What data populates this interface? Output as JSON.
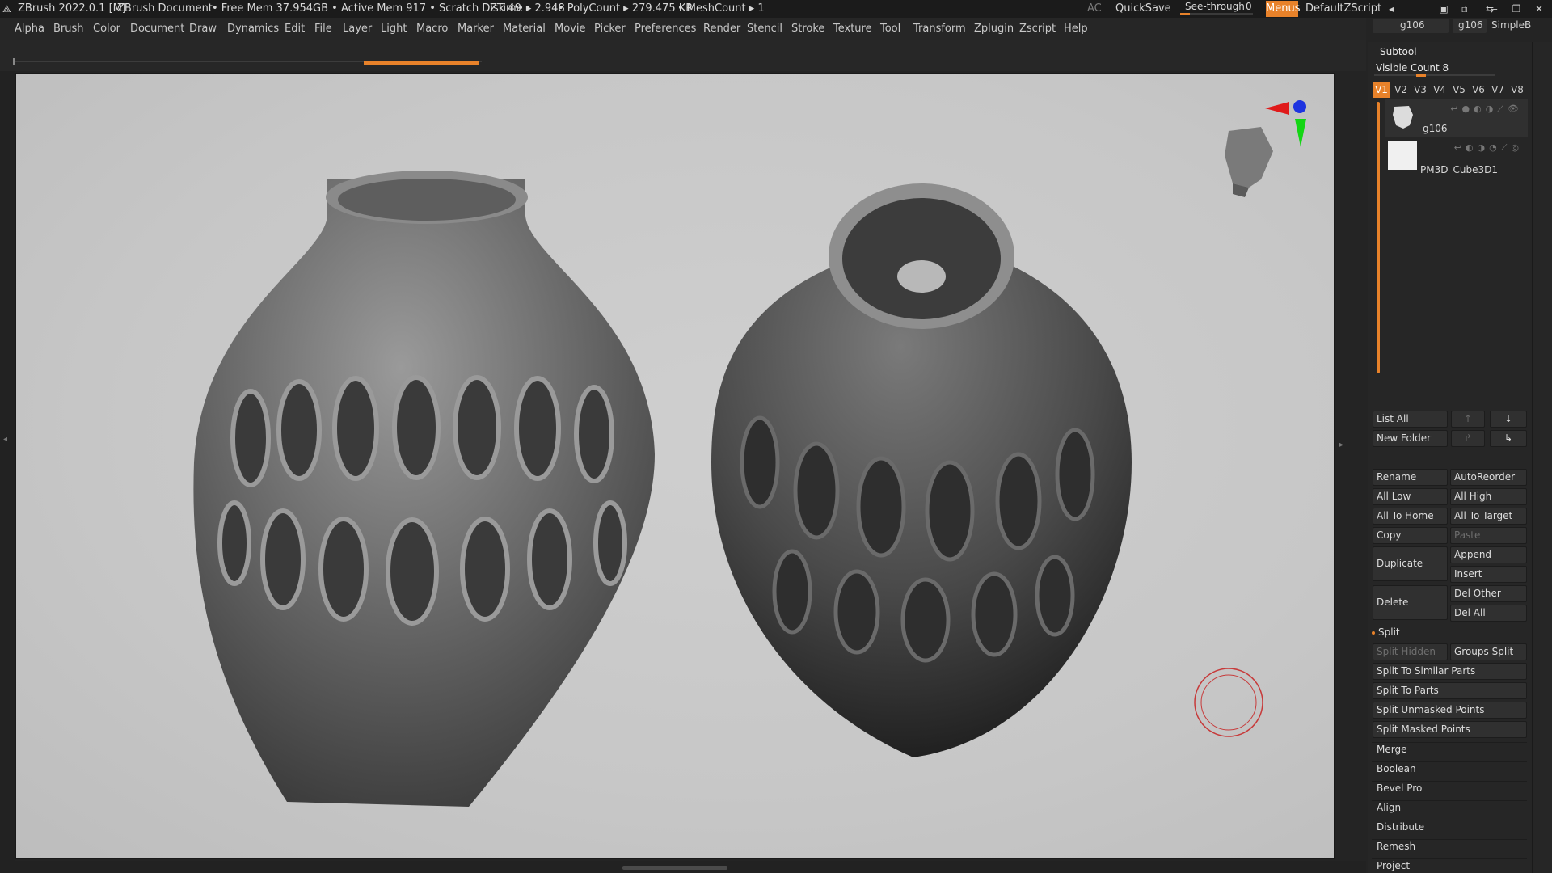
{
  "titlebar": {
    "app": "ZBrush 2022.0.1 [M]",
    "document": "ZBrush Document",
    "stats": "• Free Mem 37.954GB • Active Mem 917 • Scratch Disk 49 •",
    "ztime": "ZTime ▸ 2.948",
    "polycount": "• PolyCount ▸ 279.475 KP",
    "meshcount": "• MeshCount ▸ 1",
    "ac": "AC",
    "quicksave": "QuickSave",
    "see_through_label": "See-through",
    "see_through_value": "0",
    "menus": "Menus",
    "zscript": "DefaultZScript"
  },
  "menubar": [
    "Alpha",
    "Brush",
    "Color",
    "Document",
    "Draw",
    "Dynamics",
    "Edit",
    "File",
    "Layer",
    "Light",
    "Macro",
    "Marker",
    "Material",
    "Movie",
    "Picker",
    "Preferences",
    "Render",
    "Stencil",
    "Stroke",
    "Texture",
    "Tool",
    "Transform",
    "Zplugin",
    "Zscript",
    "Help"
  ],
  "toolslots": {
    "slot1": "g106",
    "slot2": "g106",
    "slot3": "SimpleB"
  },
  "subtool": {
    "title": "Subtool",
    "visible_count": "Visible Count 8",
    "tabs": [
      "V1",
      "V2",
      "V3",
      "V4",
      "V5",
      "V6",
      "V7",
      "V8"
    ],
    "items": [
      {
        "name": "g106"
      },
      {
        "name": "PM3D_Cube3D1"
      }
    ]
  },
  "buttons": {
    "list_all": "List All",
    "new_folder": "New Folder",
    "rename": "Rename",
    "autoreorder": "AutoReorder",
    "all_low": "All Low",
    "all_high": "All High",
    "all_to_home": "All To Home",
    "all_to_target": "All To Target",
    "copy": "Copy",
    "paste": "Paste",
    "duplicate": "Duplicate",
    "append": "Append",
    "insert": "Insert",
    "delete": "Delete",
    "del_other": "Del Other",
    "del_all": "Del All",
    "split": "Split",
    "split_hidden": "Split Hidden",
    "groups_split": "Groups Split",
    "split_similar": "Split To Similar Parts",
    "split_parts": "Split To Parts",
    "split_unmasked": "Split Unmasked Points",
    "split_masked": "Split Masked Points",
    "merge": "Merge",
    "boolean": "Boolean",
    "bevel_pro": "Bevel Pro",
    "align": "Align",
    "distribute": "Distribute",
    "remesh": "Remesh",
    "project": "Project"
  },
  "colors": {
    "accent": "#e8822a",
    "bg": "#242424",
    "viewport": "#c8c8c8"
  }
}
